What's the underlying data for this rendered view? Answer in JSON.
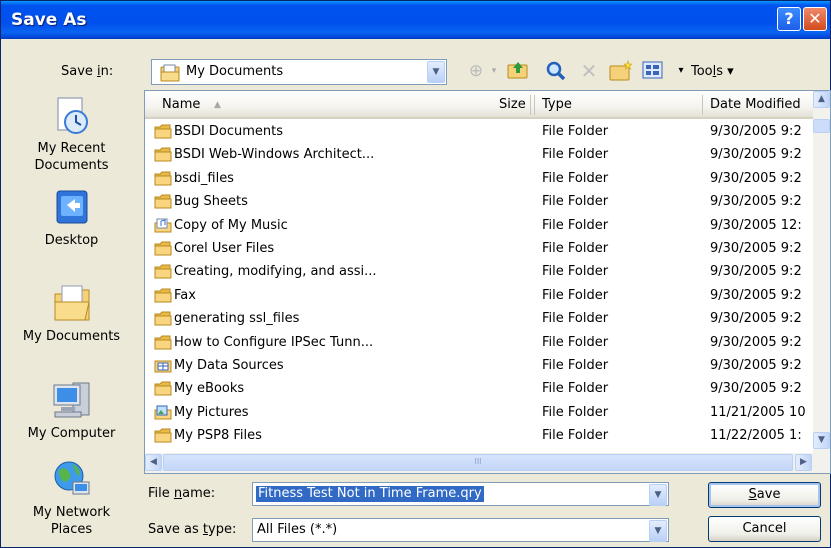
{
  "window": {
    "title": "Save As",
    "help_glyph": "?",
    "close_glyph": "✕"
  },
  "save_in": {
    "label_pre": "Save ",
    "label_key": "i",
    "label_post": "n:",
    "value": "My Documents"
  },
  "toolbar": {
    "tools_pre": "Too",
    "tools_key": "l",
    "tools_post": "s ▾"
  },
  "places": [
    {
      "line1": "My Recent",
      "line2": "Documents",
      "icon": "recent-documents-icon"
    },
    {
      "line1": "Desktop",
      "line2": "",
      "icon": "desktop-icon"
    },
    {
      "line1": "My Documents",
      "line2": "",
      "icon": "my-documents-icon"
    },
    {
      "line1": "My Computer",
      "line2": "",
      "icon": "my-computer-icon"
    },
    {
      "line1": "My Network",
      "line2": "Places",
      "icon": "network-places-icon"
    }
  ],
  "columns": {
    "name": "Name",
    "size": "Size",
    "type": "Type",
    "date": "Date Modified"
  },
  "files": [
    {
      "name": "BSDI Documents",
      "type": "File Folder",
      "date": "9/30/2005 9:2",
      "icon": "folder"
    },
    {
      "name": "BSDI Web-Windows Architect...",
      "type": "File Folder",
      "date": "9/30/2005 9:2",
      "icon": "folder"
    },
    {
      "name": "bsdi_files",
      "type": "File Folder",
      "date": "9/30/2005 9:2",
      "icon": "folder"
    },
    {
      "name": "Bug Sheets",
      "type": "File Folder",
      "date": "9/30/2005 9:2",
      "icon": "folder"
    },
    {
      "name": "Copy of My Music",
      "type": "File Folder",
      "date": "9/30/2005 12:",
      "icon": "music-folder"
    },
    {
      "name": "Corel User Files",
      "type": "File Folder",
      "date": "9/30/2005 9:2",
      "icon": "folder"
    },
    {
      "name": "Creating, modifying, and assi...",
      "type": "File Folder",
      "date": "9/30/2005 9:2",
      "icon": "folder"
    },
    {
      "name": "Fax",
      "type": "File Folder",
      "date": "9/30/2005 9:2",
      "icon": "folder"
    },
    {
      "name": "generating ssl_files",
      "type": "File Folder",
      "date": "9/30/2005 9:2",
      "icon": "folder"
    },
    {
      "name": "How to Configure IPSec Tunn...",
      "type": "File Folder",
      "date": "9/30/2005 9:2",
      "icon": "folder"
    },
    {
      "name": "My Data Sources",
      "type": "File Folder",
      "date": "9/30/2005 9:2",
      "icon": "data-sources-folder"
    },
    {
      "name": "My eBooks",
      "type": "File Folder",
      "date": "9/30/2005 9:2",
      "icon": "folder"
    },
    {
      "name": "My Pictures",
      "type": "File Folder",
      "date": "11/21/2005 10",
      "icon": "pictures-folder"
    },
    {
      "name": "My PSP8 Files",
      "type": "File Folder",
      "date": "11/22/2005 1:",
      "icon": "folder"
    }
  ],
  "file_name": {
    "label_pre": "File ",
    "label_key": "n",
    "label_post": "ame:",
    "value": "Fitness Test Not in Time Frame.qry"
  },
  "save_as_type": {
    "label_pre": "Save as ",
    "label_key": "t",
    "label_post": "ype:",
    "value": "All Files (*.*)"
  },
  "buttons": {
    "save_key": "S",
    "save_rest": "ave",
    "cancel": "Cancel"
  },
  "scroll": {
    "up": "▲",
    "down": "▼",
    "left": "◀",
    "right": "▶",
    "grip": "III"
  },
  "colors": {
    "title_bar": "#0053ee",
    "selection": "#316ac5",
    "folder": "#f5d27a"
  }
}
